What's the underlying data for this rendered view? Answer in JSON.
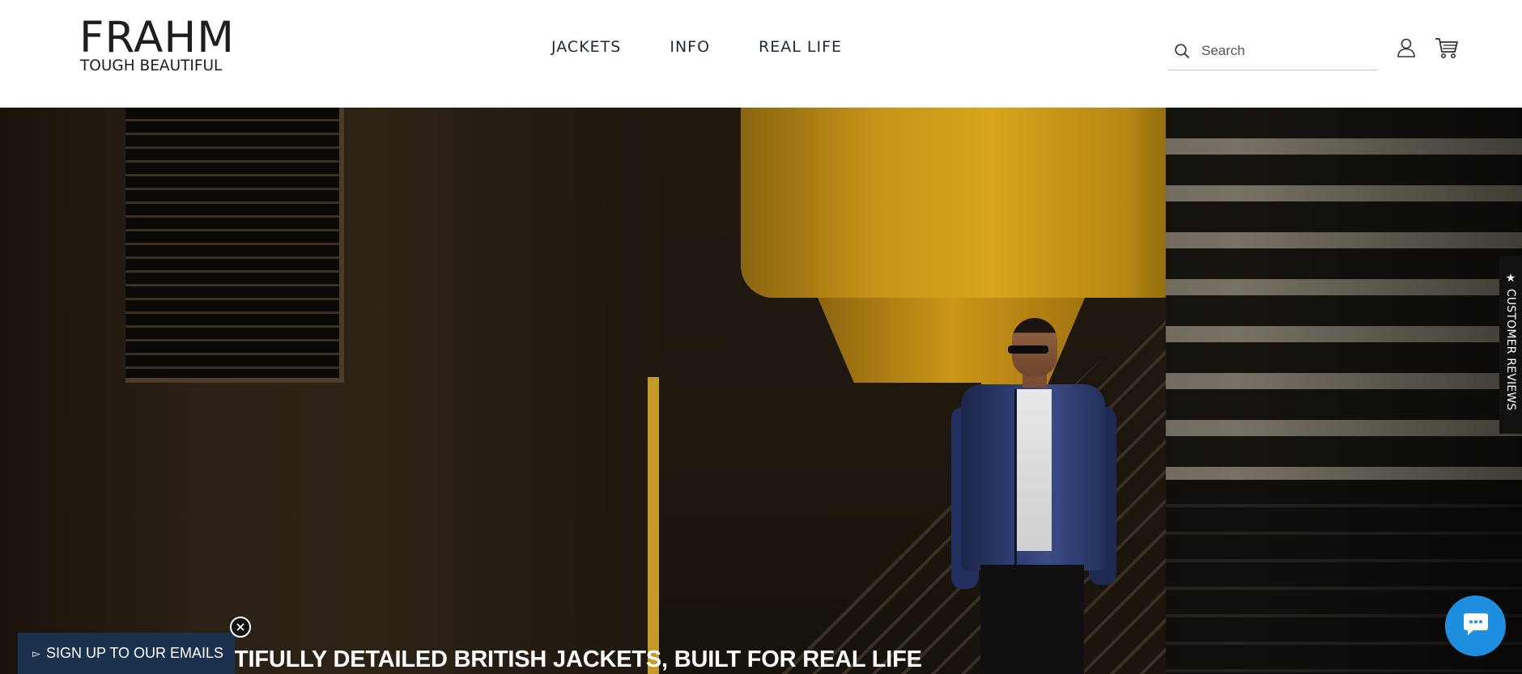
{
  "brand": {
    "name": "FRAHM",
    "tagline": "TOUGH BEAUTIFUL"
  },
  "nav": {
    "items": [
      {
        "label": "JACKETS"
      },
      {
        "label": "INFO"
      },
      {
        "label": "REAL LIFE"
      }
    ]
  },
  "search": {
    "placeholder": "Search",
    "value": ""
  },
  "header_icons": {
    "account": "user-icon",
    "cart": "cart-icon"
  },
  "hero": {
    "headline": "TIFULLY DETAILED BRITISH JACKETS, BUILT FOR REAL LIFE"
  },
  "reviews_tab": {
    "label": "★ CUSTOMER REVIEWS"
  },
  "signup": {
    "label": "SIGN UP TO OUR EMAILS",
    "arrow": "▻"
  },
  "chat": {
    "icon": "chat-bubble-icon"
  },
  "colors": {
    "header_bg": "#ffffff",
    "nav_text": "#1e2a38",
    "signup_bg": "#1a3150",
    "chat_bg": "#1e8ee0",
    "headline_text": "#ffffff"
  }
}
